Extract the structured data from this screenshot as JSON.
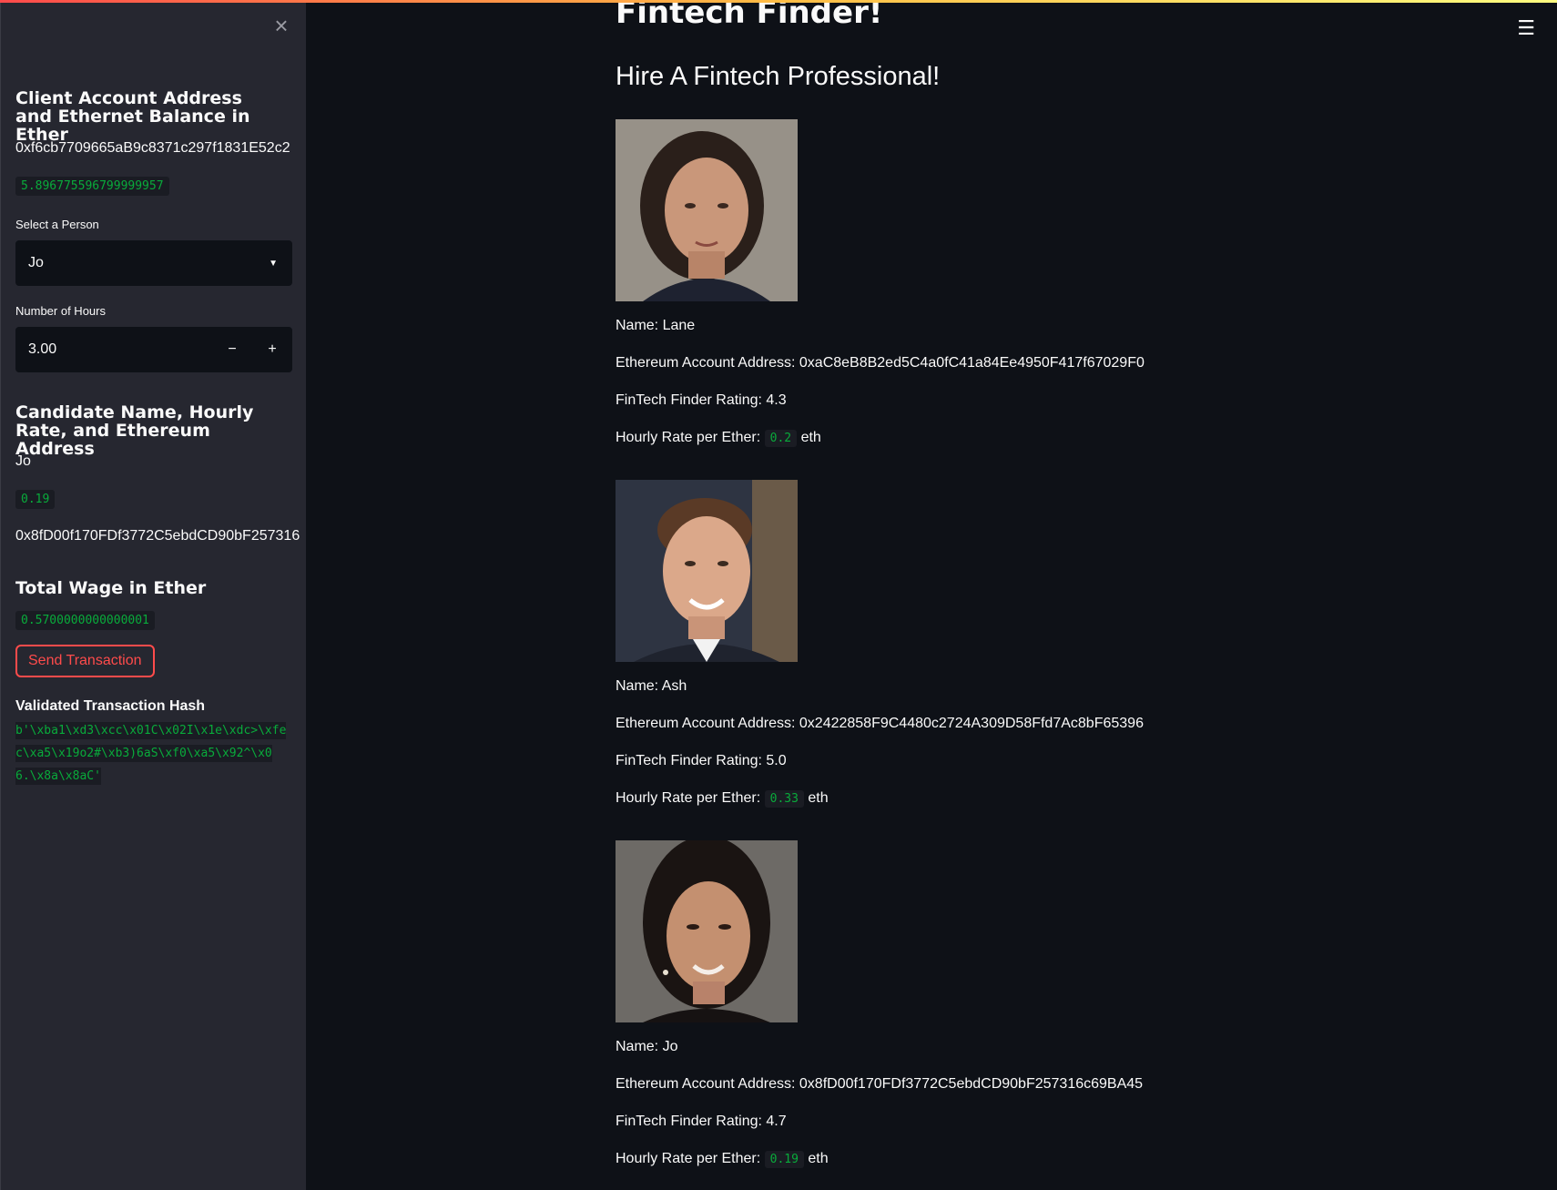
{
  "sidebar": {
    "account_heading": "Client Account Address and Ethernet Balance in Ether",
    "account_address": "0xf6cb7709665aB9c8371c297f1831E52c2",
    "balance": "5.896775596799999957",
    "select_label": "Select a Person",
    "select_value": "Jo",
    "hours_label": "Number of Hours",
    "hours_value": "3.00",
    "minus": "−",
    "plus": "+",
    "candidate_heading": "Candidate Name, Hourly Rate, and Ethereum Address",
    "candidate_name": "Jo",
    "candidate_rate": "0.19",
    "candidate_address": "0x8fD00f170FDf3772C5ebdCD90bF257316",
    "wage_heading": "Total Wage in Ether",
    "wage_value": "0.5700000000000001",
    "send_button": "Send Transaction",
    "hash_label": "Validated Transaction Hash",
    "hash_value": "b'\\xba1\\xd3\\xcc\\x01C\\x02I\\x1e\\xdc>\\xfec\\xa5\\x19o2#\\xb3)6aS\\xf0\\xa5\\x92^\\x06.\\x8a\\x8aC'"
  },
  "main": {
    "title": "Fintech Finder!",
    "subtitle": "Hire A Fintech Professional!",
    "candidates": [
      {
        "name": "Name: Lane",
        "address": "Ethereum Account Address: 0xaC8eB8B2ed5C4a0fC41a84Ee4950F417f67029F0",
        "rating": "FinTech Finder Rating: 4.3",
        "rate_label": "Hourly Rate per Ether:",
        "rate": "0.2",
        "unit": "eth"
      },
      {
        "name": "Name: Ash",
        "address": "Ethereum Account Address: 0x2422858F9C4480c2724A309D58Ffd7Ac8bF65396",
        "rating": "FinTech Finder Rating: 5.0",
        "rate_label": "Hourly Rate per Ether:",
        "rate": "0.33",
        "unit": "eth"
      },
      {
        "name": "Name: Jo",
        "address": "Ethereum Account Address: 0x8fD00f170FDf3772C5ebdCD90bF257316c69BA45",
        "rating": "FinTech Finder Rating: 4.7",
        "rate_label": "Hourly Rate per Ether:",
        "rate": "0.19",
        "unit": "eth"
      }
    ]
  },
  "icons": {
    "close": "close-icon",
    "menu": "hamburger-menu-icon",
    "caret": "chevron-down-icon"
  }
}
